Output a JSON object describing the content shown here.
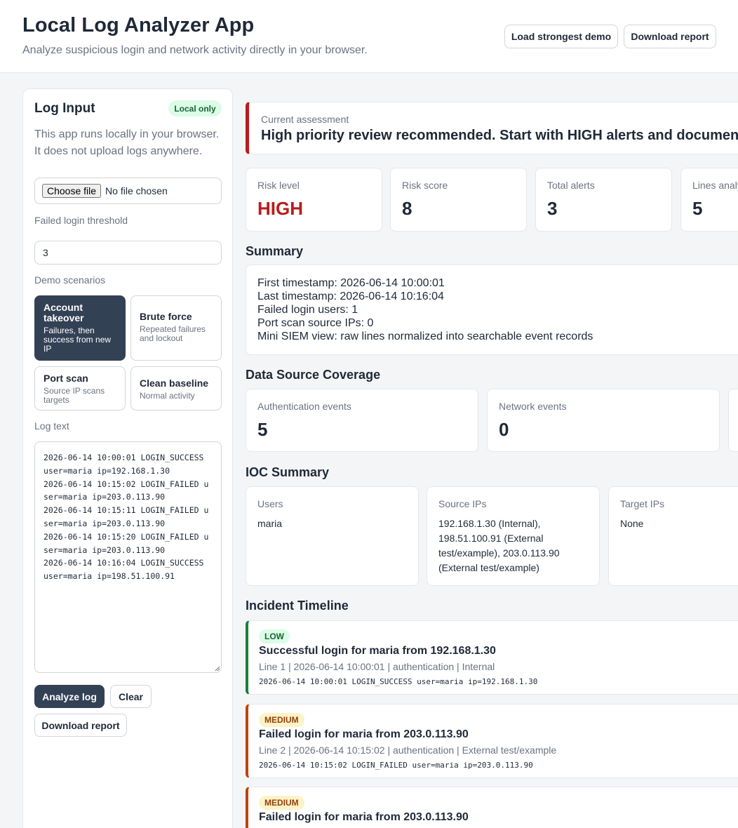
{
  "header": {
    "title": "Local Log Analyzer App",
    "subtitle": "Analyze suspicious login and network activity directly in your browser.",
    "load_demo_label": "Load strongest demo",
    "download_label": "Download report"
  },
  "input_panel": {
    "title": "Log Input",
    "badge": "Local only",
    "note": "This app runs locally in your browser. It does not upload logs anywhere.",
    "file_button": "Choose file",
    "file_status": "No file chosen",
    "threshold_label": "Failed login threshold",
    "threshold_value": "3",
    "scenarios_label": "Demo scenarios",
    "scenarios": [
      {
        "title": "Account takeover",
        "desc": "Failures, then success from new IP",
        "active": true
      },
      {
        "title": "Brute force",
        "desc": "Repeated failures and lockout",
        "active": false
      },
      {
        "title": "Port scan",
        "desc": "Source IP scans targets",
        "active": false
      },
      {
        "title": "Clean baseline",
        "desc": "Normal activity",
        "active": false
      }
    ],
    "log_text_label": "Log text",
    "log_text": "2026-06-14 10:00:01 LOGIN_SUCCESS user=maria ip=192.168.1.30\n2026-06-14 10:15:02 LOGIN_FAILED user=maria ip=203.0.113.90\n2026-06-14 10:15:11 LOGIN_FAILED user=maria ip=203.0.113.90\n2026-06-14 10:15:20 LOGIN_FAILED user=maria ip=203.0.113.90\n2026-06-14 10:16:04 LOGIN_SUCCESS user=maria ip=198.51.100.91",
    "analyze_label": "Analyze log",
    "clear_label": "Clear",
    "download_label": "Download report"
  },
  "assessment": {
    "label": "Current assessment",
    "text": "High priority review recommended. Start with HIGH alerts and document"
  },
  "metrics": [
    {
      "label": "Risk level",
      "value": "HIGH"
    },
    {
      "label": "Risk score",
      "value": "8"
    },
    {
      "label": "Total alerts",
      "value": "3"
    },
    {
      "label": "Lines analyzed",
      "value": "5"
    }
  ],
  "summary": {
    "title": "Summary",
    "lines": [
      "First timestamp: 2026-06-14 10:00:01",
      "Last timestamp: 2026-06-14 10:16:04",
      "Failed login users: 1",
      "Port scan source IPs: 0",
      "Mini SIEM view: raw lines normalized into searchable event records"
    ]
  },
  "coverage": {
    "title": "Data Source Coverage",
    "items": [
      {
        "label": "Authentication events",
        "value": "5"
      },
      {
        "label": "Network events",
        "value": "0"
      }
    ]
  },
  "ioc": {
    "title": "IOC Summary",
    "items": [
      {
        "label": "Users",
        "value": "maria"
      },
      {
        "label": "Source IPs",
        "value": "192.168.1.30 (Internal), 198.51.100.91 (External test/example), 203.0.113.90 (External test/example)"
      },
      {
        "label": "Target IPs",
        "value": "None"
      }
    ]
  },
  "timeline": {
    "title": "Incident Timeline",
    "events": [
      {
        "severity": "LOW",
        "title": "Successful login for maria from 192.168.1.30",
        "meta": "Line 1 | 2026-06-14 10:00:01 | authentication | Internal",
        "raw": "2026-06-14 10:00:01 LOGIN_SUCCESS user=maria ip=192.168.1.30"
      },
      {
        "severity": "MEDIUM",
        "title": "Failed login for maria from 203.0.113.90",
        "meta": "Line 2 | 2026-06-14 10:15:02 | authentication | External test/example",
        "raw": "2026-06-14 10:15:02 LOGIN_FAILED user=maria ip=203.0.113.90"
      },
      {
        "severity": "MEDIUM",
        "title": "Failed login for maria from 203.0.113.90",
        "meta": "",
        "raw": ""
      }
    ]
  },
  "colors": {
    "high": "#b91c1c",
    "low_border": "#15803d",
    "low_badge_bg": "#dcfce7",
    "low_badge_text": "#166534",
    "medium_border": "#c2410c",
    "medium_badge_bg": "#fef3c7",
    "medium_badge_text": "#92400e",
    "dark_button": "#334155"
  }
}
